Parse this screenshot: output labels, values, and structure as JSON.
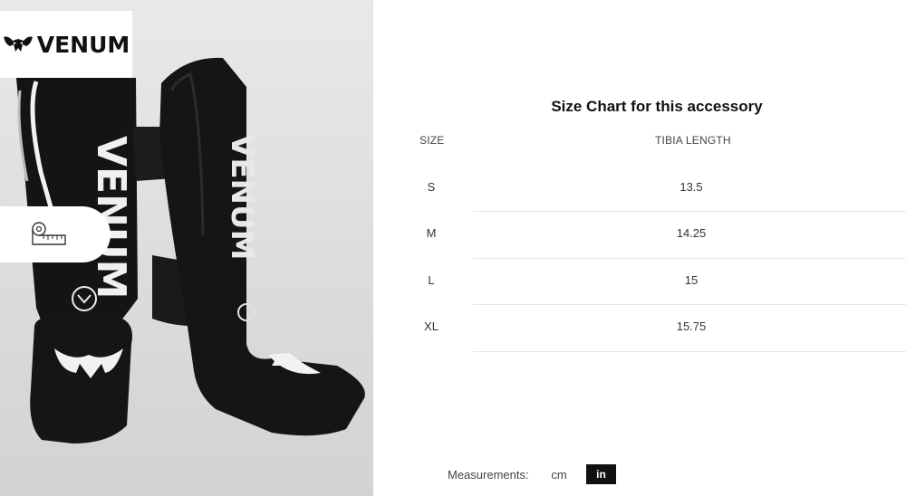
{
  "brand": {
    "logo_text": "VENUM"
  },
  "size_chart": {
    "title": "Size Chart for this accessory",
    "columns": [
      "SIZE",
      "TIBIA LENGTH"
    ],
    "rows": [
      {
        "size": "S",
        "tibia_length": "13.5"
      },
      {
        "size": "M",
        "tibia_length": "14.25"
      },
      {
        "size": "L",
        "tibia_length": "15"
      },
      {
        "size": "XL",
        "tibia_length": "15.75"
      }
    ]
  },
  "measurements": {
    "label": "Measurements:",
    "options": [
      "cm",
      "in"
    ],
    "selected": "in"
  },
  "icons": {
    "logo": "venum-snake-logo-icon",
    "size_guide": "measuring-tape-icon"
  },
  "colors": {
    "accent": "#111111",
    "panel_bg": "#dddddd"
  }
}
